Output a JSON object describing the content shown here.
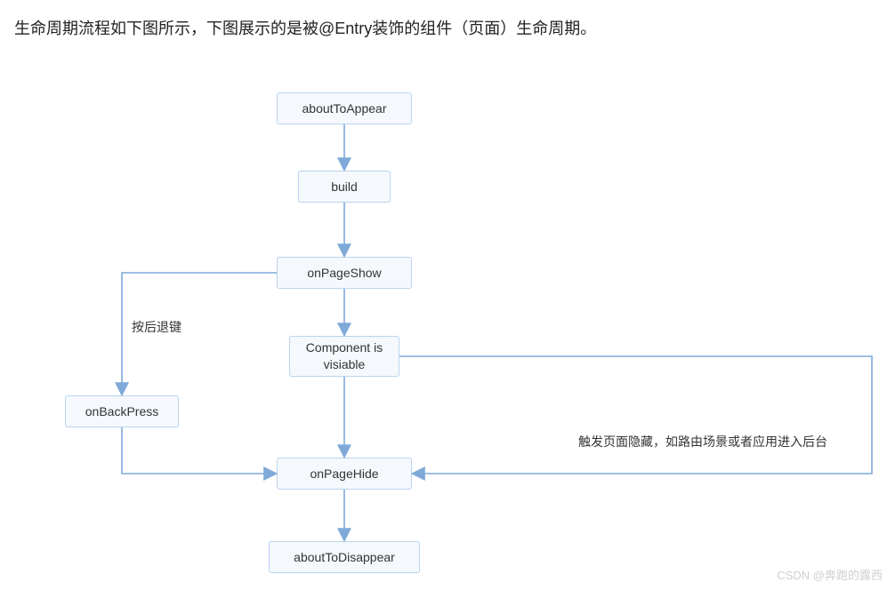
{
  "title": "生命周期流程如下图所示，下图展示的是被@Entry装饰的组件（页面）生命周期。",
  "nodes": {
    "aboutToAppear": "aboutToAppear",
    "build": "build",
    "onPageShow": "onPageShow",
    "componentVisible": "Component is\nvisiable",
    "onBackPress": "onBackPress",
    "onPageHide": "onPageHide",
    "aboutToDisappear": "aboutToDisappear"
  },
  "labels": {
    "backKey": "按后退键",
    "triggerHide": "触发页面隐藏，如路由场景或者应用进入后台"
  },
  "watermark": "CSDN @奔跑的露西"
}
